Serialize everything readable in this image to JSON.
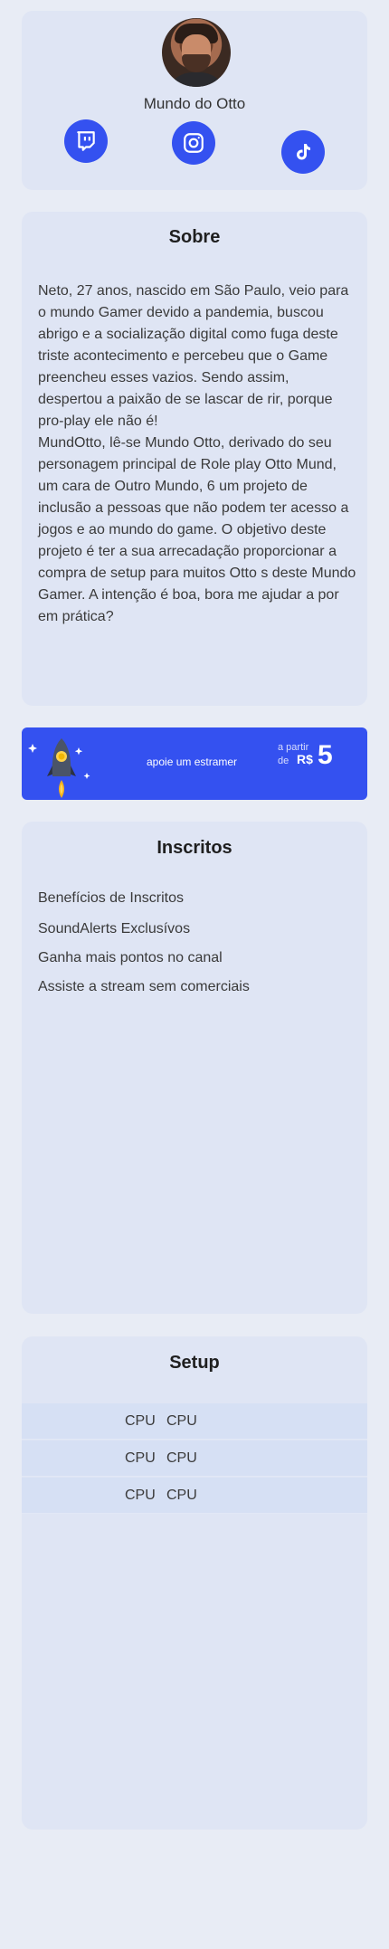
{
  "profile": {
    "name": "Mundo do Otto",
    "socials": [
      {
        "icon": "twitch-icon"
      },
      {
        "icon": "instagram-icon"
      },
      {
        "icon": "tiktok-icon"
      }
    ]
  },
  "sobre": {
    "title": "Sobre",
    "text": "Neto, 27 anos, nascido em São Paulo, veio para o mundo Gamer devido a pandemia, buscou abrigo e a socialização digital como fuga deste triste acontecimento e percebeu que o Game preencheu esses vazios. Sendo assim, despertou a paixão de se lascar de rir, porque pro-play ele não é!\nMundOtto, lê-se Mundo Otto, derivado do seu personagem principal de Role play Otto Mund, um cara de Outro Mundo, 6 um projeto de inclusão a pessoas que não podem ter acesso a jogos e ao mundo do game. O objetivo deste projeto é ter a sua arrecadação proporcionar a compra de setup para muitos Otto s deste Mundo Gamer. A intenção é boa, bora me ajudar a por em prática?"
  },
  "banner": {
    "text": "apoie um estramer",
    "a_partir": "a partir",
    "de": "de",
    "currency": "R$",
    "price": "5",
    "colors": {
      "background": "#3451f0"
    }
  },
  "inscritos": {
    "title": "Inscritos",
    "items": [
      "Benefícios de Inscritos",
      "SoundAlerts Exclusívos",
      "Ganha mais pontos no canal",
      "Assiste a stream sem comerciais"
    ]
  },
  "setup": {
    "title": "Setup",
    "rows": [
      [
        "CPU",
        "CPU"
      ],
      [
        "CPU",
        "CPU"
      ],
      [
        "CPU",
        "CPU"
      ]
    ]
  }
}
